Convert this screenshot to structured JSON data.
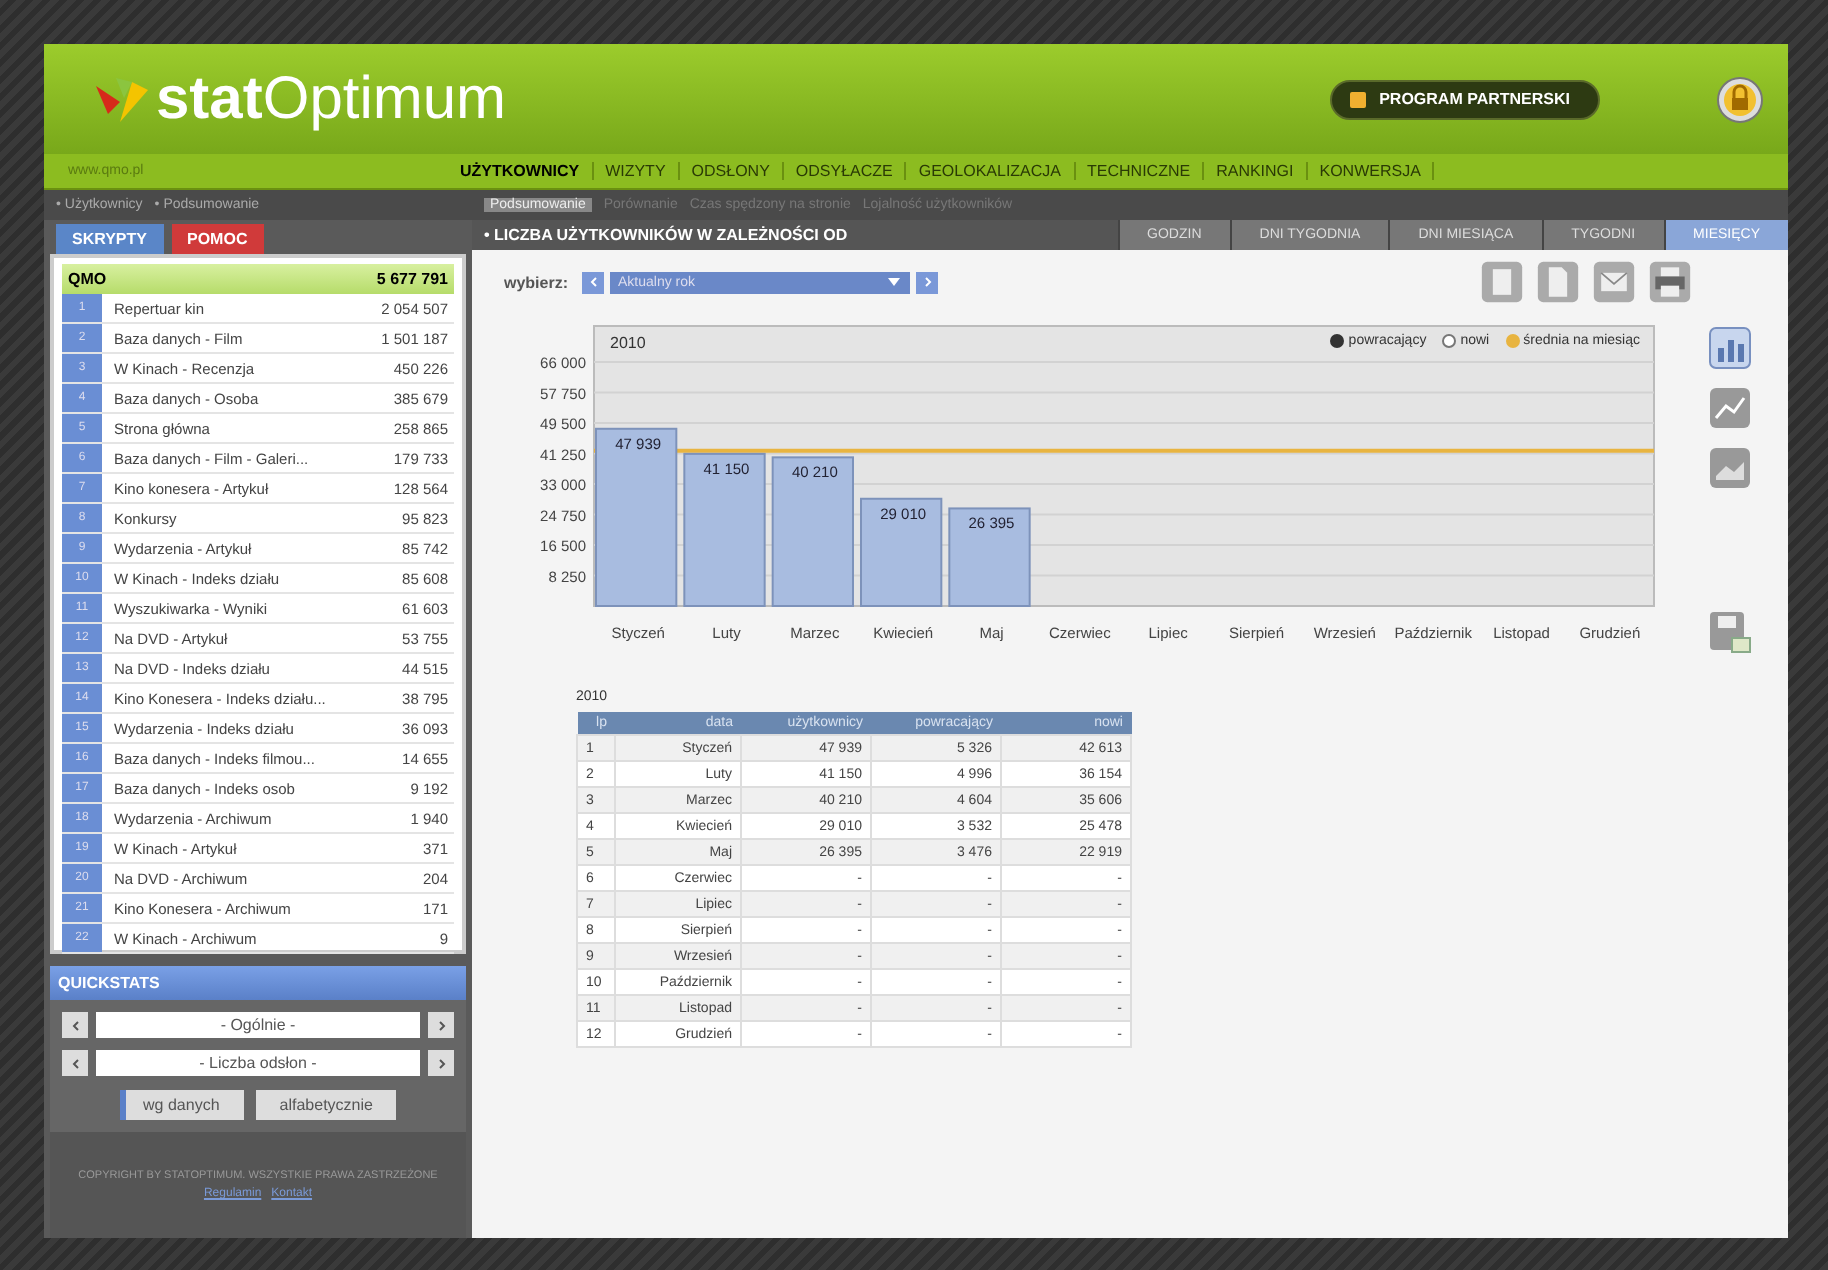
{
  "header": {
    "logo_bold": "stat",
    "logo_light": "Optimum",
    "site": "www.qmo.pl",
    "partner_button": "PROGRAM PARTNERSKI"
  },
  "nav": [
    {
      "label": "UŻYTKOWNICY",
      "selected": true
    },
    {
      "label": "WIZYTY",
      "selected": false
    },
    {
      "label": "ODSŁONY",
      "selected": false
    },
    {
      "label": "ODSYŁACZE",
      "selected": false
    },
    {
      "label": "GEOLOKALIZACJA",
      "selected": false
    },
    {
      "label": "TECHNICZNE",
      "selected": false
    },
    {
      "label": "RANKINGI",
      "selected": false
    },
    {
      "label": "KONWERSJA",
      "selected": false
    }
  ],
  "breadcrumb": [
    "• Użytkownicy",
    "• Podsumowanie"
  ],
  "subnav": [
    {
      "label": "Podsumowanie",
      "selected": true
    },
    {
      "label": "Porównanie",
      "selected": false
    },
    {
      "label": "Czas spędzony na stronie",
      "selected": false
    },
    {
      "label": "Lojalność użytkowników",
      "selected": false
    }
  ],
  "sidebar": {
    "tabs": [
      {
        "label": "SKRYPTY",
        "selected": true
      },
      {
        "label": "POMOC",
        "selected": false
      }
    ],
    "total": {
      "label": "QMO",
      "value": "5 677 791"
    },
    "items": [
      {
        "n": "1",
        "label": "Repertuar kin",
        "value": "2 054 507"
      },
      {
        "n": "2",
        "label": "Baza danych - Film",
        "value": "1 501 187"
      },
      {
        "n": "3",
        "label": "W Kinach - Recenzja",
        "value": "450 226"
      },
      {
        "n": "4",
        "label": "Baza danych - Osoba",
        "value": "385 679"
      },
      {
        "n": "5",
        "label": "Strona główna",
        "value": "258 865"
      },
      {
        "n": "6",
        "label": "Baza danych - Film - Galeri...",
        "value": "179 733"
      },
      {
        "n": "7",
        "label": "Kino konesera - Artykuł",
        "value": "128 564"
      },
      {
        "n": "8",
        "label": "Konkursy",
        "value": "95 823"
      },
      {
        "n": "9",
        "label": "Wydarzenia - Artykuł",
        "value": "85 742"
      },
      {
        "n": "10",
        "label": "W Kinach - Indeks działu",
        "value": "85 608"
      },
      {
        "n": "11",
        "label": "Wyszukiwarka - Wyniki",
        "value": "61 603"
      },
      {
        "n": "12",
        "label": "Na DVD - Artykuł",
        "value": "53 755"
      },
      {
        "n": "13",
        "label": "Na DVD - Indeks działu",
        "value": "44 515"
      },
      {
        "n": "14",
        "label": "Kino Konesera - Indeks działu...",
        "value": "38 795"
      },
      {
        "n": "15",
        "label": "Wydarzenia - Indeks działu",
        "value": "36 093"
      },
      {
        "n": "16",
        "label": "Baza danych - Indeks filmou...",
        "value": "14 655"
      },
      {
        "n": "17",
        "label": "Baza danych - Indeks osob",
        "value": "9 192"
      },
      {
        "n": "18",
        "label": "Wydarzenia - Archiwum",
        "value": "1 940"
      },
      {
        "n": "19",
        "label": "W Kinach - Artykuł",
        "value": "371"
      },
      {
        "n": "20",
        "label": "Na DVD - Archiwum",
        "value": "204"
      },
      {
        "n": "21",
        "label": "Kino Konesera - Archiwum",
        "value": "171"
      },
      {
        "n": "22",
        "label": "W Kinach - Archiwum",
        "value": "9"
      }
    ],
    "quickstats": {
      "title": "QUICKSTATS",
      "selects": [
        "- Ogólnie -",
        "- Liczba odsłon -"
      ],
      "sort": [
        {
          "label": "wg danych",
          "selected": true
        },
        {
          "label": "alfabetycznie",
          "selected": false
        }
      ]
    },
    "footer": {
      "copyright": "COPYRIGHT BY STATOPTIMUM. WSZYSTKIE PRAWA ZASTRZEŻONE",
      "links": [
        "Regulamin",
        "Kontakt"
      ]
    }
  },
  "content": {
    "title": "• LICZBA UŻYTKOWNIKÓW W ZALEŻNOŚCI OD",
    "tabs": [
      {
        "label": "GODZIN",
        "selected": false
      },
      {
        "label": "DNI TYGODNIA",
        "selected": false
      },
      {
        "label": "DNI MIESIĄCA",
        "selected": false
      },
      {
        "label": "TYGODNI",
        "selected": false
      },
      {
        "label": "MIESIĘCY",
        "selected": true
      }
    ],
    "picker": {
      "label": "wybierz:",
      "value": "Aktualny rok"
    },
    "legend": [
      {
        "label": "powracający",
        "checked": true,
        "color": "#333333"
      },
      {
        "label": "nowi",
        "checked": false,
        "color": "#ffffff"
      },
      {
        "label": "średnia na miesiąc",
        "checked": true,
        "color": "#e8b440"
      }
    ],
    "chart_data": {
      "type": "bar",
      "title": "2010",
      "categories": [
        "Styczeń",
        "Luty",
        "Marzec",
        "Kwiecień",
        "Maj",
        "Czerwiec",
        "Lipiec",
        "Sierpień",
        "Wrzesień",
        "Październik",
        "Listopad",
        "Grudzień"
      ],
      "values": [
        47939,
        41150,
        40210,
        29010,
        26395,
        null,
        null,
        null,
        null,
        null,
        null,
        null
      ],
      "ylim": [
        0,
        66000
      ],
      "grid": true,
      "yticks": [
        {
          "value": 8250,
          "label": "8 250"
        },
        {
          "value": 16500,
          "label": "16 500"
        },
        {
          "value": 24750,
          "label": "24 750"
        },
        {
          "value": 33000,
          "label": "33 000"
        },
        {
          "value": 41250,
          "label": "41 250"
        },
        {
          "value": 49500,
          "label": "49 500"
        },
        {
          "value": 57750,
          "label": "57 750"
        },
        {
          "value": 66000,
          "label": "66 000"
        }
      ],
      "value_labels": [
        "47 939",
        "41 150",
        "40 210",
        "29 010",
        "26 395",
        null,
        null,
        null,
        null,
        null,
        null,
        null
      ],
      "ref_lines": [
        {
          "axis": "y",
          "value": 42000,
          "color": "#e8b440"
        }
      ]
    },
    "table": {
      "caption": "2010",
      "columns": [
        "lp",
        "data",
        "użytkownicy",
        "powracający",
        "nowi"
      ],
      "rows": [
        [
          "1",
          "Styczeń",
          "47 939",
          "5 326",
          "42 613"
        ],
        [
          "2",
          "Luty",
          "41 150",
          "4 996",
          "36 154"
        ],
        [
          "3",
          "Marzec",
          "40 210",
          "4 604",
          "35 606"
        ],
        [
          "4",
          "Kwiecień",
          "29 010",
          "3 532",
          "25 478"
        ],
        [
          "5",
          "Maj",
          "26 395",
          "3 476",
          "22 919"
        ],
        [
          "6",
          "Czerwiec",
          "-",
          "-",
          "-"
        ],
        [
          "7",
          "Lipiec",
          "-",
          "-",
          "-"
        ],
        [
          "8",
          "Sierpień",
          "-",
          "-",
          "-"
        ],
        [
          "9",
          "Wrzesień",
          "-",
          "-",
          "-"
        ],
        [
          "10",
          "Październik",
          "-",
          "-",
          "-"
        ],
        [
          "11",
          "Listopad",
          "-",
          "-",
          "-"
        ],
        [
          "12",
          "Grudzień",
          "-",
          "-",
          "-"
        ]
      ]
    }
  }
}
